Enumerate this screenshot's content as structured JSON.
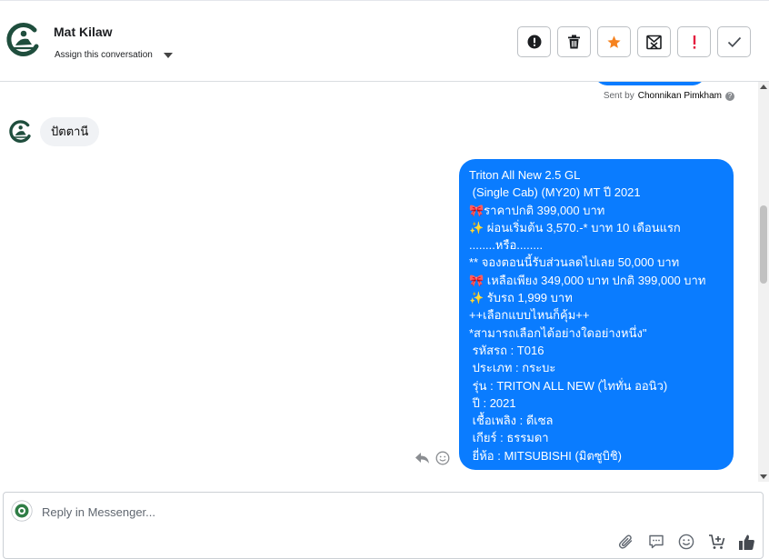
{
  "header": {
    "contact_name": "Mat Kilaw",
    "assign_label": "Assign this conversation"
  },
  "actions": [
    {
      "name": "report-button",
      "icon": "alert-circle-icon"
    },
    {
      "name": "delete-button",
      "icon": "trash-icon"
    },
    {
      "name": "star-button",
      "icon": "star-icon"
    },
    {
      "name": "mark-spam-button",
      "icon": "mail-x-icon"
    },
    {
      "name": "important-button",
      "icon": "exclamation-icon"
    },
    {
      "name": "done-button",
      "icon": "check-icon"
    }
  ],
  "thread": {
    "sent_by_prefix": "Sent by",
    "sent_by_name": "Chonnikan Pimkham",
    "incoming_message": "ปัตตานี",
    "outgoing_message": "Triton All New 2.5 GL\n (Single Cab) (MY20) MT ปี 2021\n🎀ราคาปกติ 399,000 บาท\n✨ ผ่อนเริ่มต้น 3,570.-* บาท 10 เดือนแรก\n........หรือ........\n** จองตอนนี้รับส่วนลดไปเลย 50,000 บาท\n🎀 เหลือเพียง 349,000 บาท ปกติ 399,000 บาท\n✨ รับรถ 1,999 บาท\n++เลือกแบบไหนก็คุ้ม++\n*สามารถเลือกได้อย่างใดอย่างหนึ่ง\"\n รหัสรถ : T016\n ประเภท : กระบะ\n รุ่น : TRITON ALL NEW (ไททั่น ออนิว)\n ปี : 2021\n เชื้อเพลิง : ดีเซล\n เกียร์ : ธรรมดา\n ยี่ห้อ : MITSUBISHI (มิตซูบิชิ)"
  },
  "composer": {
    "placeholder": "Reply in Messenger..."
  },
  "colors": {
    "brand_green": "#1f4e3d",
    "bubble_blue": "#0a7cff",
    "bubble_grey": "#f0f2f5",
    "star_orange": "#f5821f",
    "alert_red": "#e41e3f"
  }
}
